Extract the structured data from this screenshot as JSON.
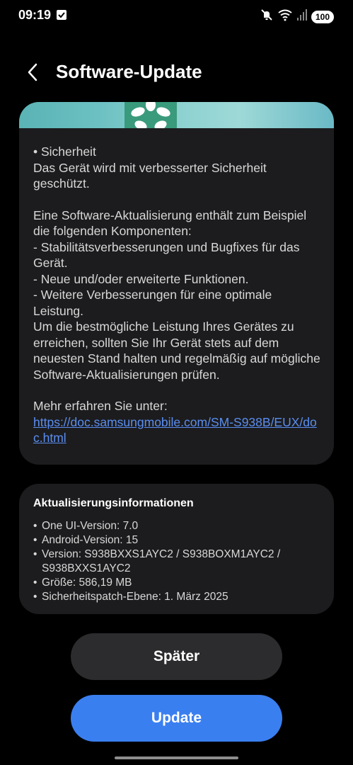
{
  "status_bar": {
    "time": "09:19",
    "battery": "100"
  },
  "header": {
    "title": "Software-Update"
  },
  "changelog": {
    "security_heading": "• Sicherheit",
    "security_text": "Das Gerät wird mit verbesserter Sicherheit geschützt.",
    "components_text": "Eine Software-Aktualisierung enthält zum Beispiel die folgenden Komponenten:",
    "item1": " - Stabilitätsverbesserungen und Bugfixes für das Gerät.",
    "item2": " - Neue und/oder erweiterte Funktionen.",
    "item3": " - Weitere Verbesserungen für eine optimale Leistung.",
    "advice_text": "Um die bestmögliche Leistung Ihres Gerätes zu erreichen, sollten Sie Ihr Gerät stets auf dem neuesten Stand halten und regelmäßig auf mögliche Software-Aktualisierungen prüfen.",
    "more_info_label": "Mehr erfahren Sie unter:",
    "link": "https://doc.samsungmobile.com/SM-S938B/EUX/doc.html"
  },
  "update_info": {
    "title": "Aktualisierungsinformationen",
    "items": [
      "One UI-Version: 7.0",
      "Android-Version: 15",
      "Version: S938BXXS1AYC2 / S938BOXM1AYC2 / S938BXXS1AYC2",
      "Größe: 586,19 MB",
      "Sicherheitspatch-Ebene: 1. März 2025"
    ]
  },
  "buttons": {
    "later": "Später",
    "update": "Update"
  },
  "colors": {
    "background": "#000000",
    "card": "#1c1c1e",
    "secondary_button": "#2c2c2e",
    "primary_button": "#3a7ff0",
    "link": "#5b8ef0"
  },
  "icons": {
    "status_check": "checkbox-icon",
    "mute": "mute-icon",
    "wifi": "wifi-icon",
    "signal": "signal-icon",
    "back": "chevron-left-icon"
  }
}
